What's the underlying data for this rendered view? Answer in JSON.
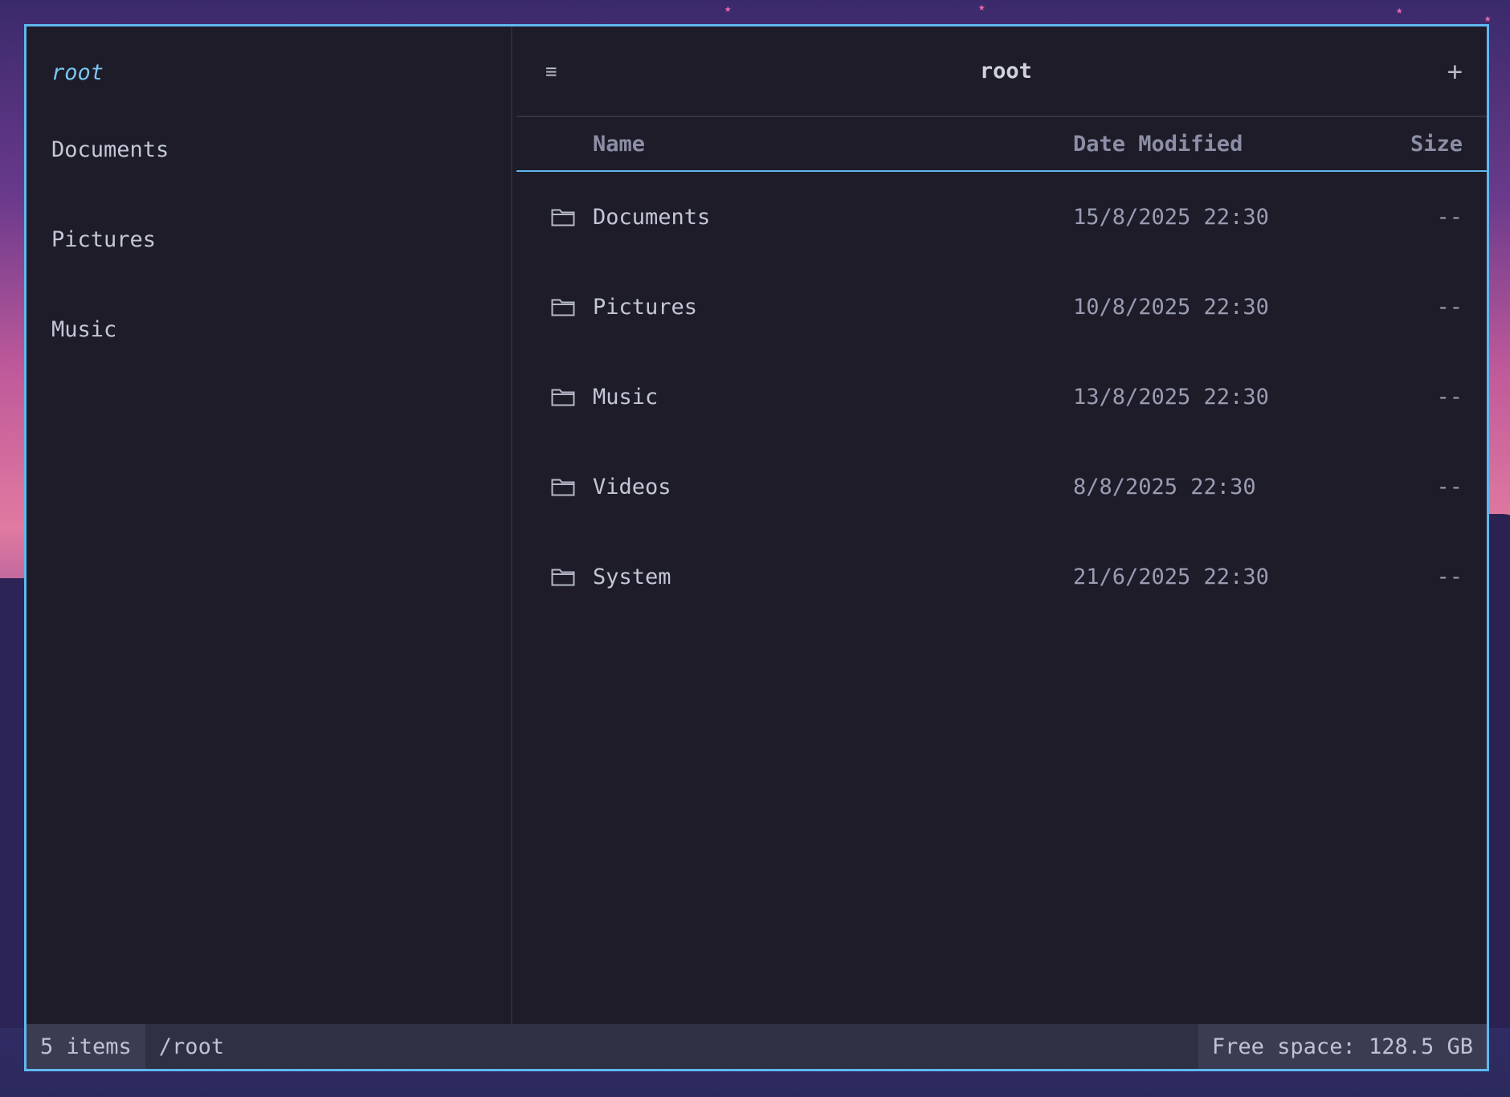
{
  "sidebar": {
    "title": "root",
    "items": [
      {
        "label": "Documents"
      },
      {
        "label": "Pictures"
      },
      {
        "label": "Music"
      }
    ]
  },
  "toolbar": {
    "menu_icon": "hamburger-menu-icon",
    "title": "root",
    "add_icon": "plus-icon"
  },
  "table": {
    "headers": {
      "name": "Name",
      "date": "Date Modified",
      "size": "Size"
    },
    "rows": [
      {
        "icon": "folder-icon",
        "name": "Documents",
        "date": "15/8/2025 22:30",
        "size": "--"
      },
      {
        "icon": "folder-icon",
        "name": "Pictures",
        "date": "10/8/2025 22:30",
        "size": "--"
      },
      {
        "icon": "folder-icon",
        "name": "Music",
        "date": "13/8/2025 22:30",
        "size": "--"
      },
      {
        "icon": "folder-icon",
        "name": "Videos",
        "date": "8/8/2025 22:30",
        "size": "--"
      },
      {
        "icon": "folder-icon",
        "name": "System",
        "date": "21/6/2025 22:30",
        "size": "--"
      }
    ]
  },
  "statusbar": {
    "count": "5 items",
    "path": "/root",
    "free_space": "Free space: 128.5 GB"
  },
  "colors": {
    "accent": "#5fb8f0",
    "window_bg": "#1d1c28",
    "sidebar_title": "#7cc6f2"
  }
}
